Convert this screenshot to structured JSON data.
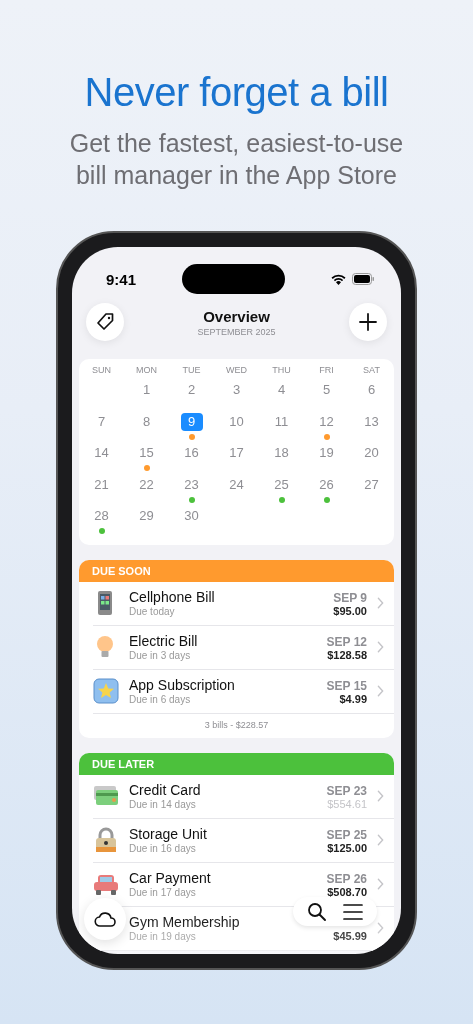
{
  "headline": "Never forget a bill",
  "subtitle": "Get the fastest, easiest-to-use bill manager in the App Store",
  "status_bar": {
    "time": "9:41"
  },
  "header": {
    "title": "Overview",
    "subtitle": "SEPTEMBER 2025"
  },
  "calendar": {
    "weekdays": [
      "SUN",
      "MON",
      "TUE",
      "WED",
      "THU",
      "FRI",
      "SAT"
    ],
    "weeks": [
      [
        {
          "day": "1",
          "selected": false
        },
        {
          "day": "2",
          "selected": false
        },
        {
          "day": "3",
          "selected": false
        },
        {
          "day": "4",
          "selected": false
        },
        {
          "day": "5",
          "selected": false
        },
        {
          "day": "6",
          "selected": false
        }
      ],
      [
        {
          "day": "7",
          "selected": false
        },
        {
          "day": "8",
          "selected": false
        },
        {
          "day": "9",
          "selected": true,
          "color": "#ff9a2e"
        },
        {
          "day": "10",
          "selected": false
        },
        {
          "day": "11",
          "selected": false
        },
        {
          "day": "12",
          "selected": false,
          "color": "#ff9a2e"
        },
        {
          "day": "13",
          "selected": false
        }
      ],
      [
        {
          "day": "14",
          "selected": false
        },
        {
          "day": "15",
          "selected": false,
          "color": "#ff9a2e"
        },
        {
          "day": "16",
          "selected": false
        },
        {
          "day": "17",
          "selected": false
        },
        {
          "day": "18",
          "selected": false
        },
        {
          "day": "19",
          "selected": false
        },
        {
          "day": "20",
          "selected": false
        }
      ],
      [
        {
          "day": "21",
          "selected": false
        },
        {
          "day": "22",
          "selected": false
        },
        {
          "day": "23",
          "selected": false,
          "color": "#4cc13c"
        },
        {
          "day": "24",
          "selected": false
        },
        {
          "day": "25",
          "selected": false,
          "color": "#4cc13c"
        },
        {
          "day": "26",
          "selected": false,
          "color": "#4cc13c"
        },
        {
          "day": "27",
          "selected": false
        }
      ],
      [
        {
          "day": "28",
          "selected": false,
          "color": "#4cc13c"
        },
        {
          "day": "29",
          "selected": false
        },
        {
          "day": "30",
          "selected": false
        }
      ]
    ]
  },
  "sections": [
    {
      "title": "DUE SOON",
      "color": "#ff9a2e",
      "footer": "3 bills - $228.57",
      "bills": [
        {
          "kind": "phone",
          "name": "Cellphone Bill",
          "due": "Due today",
          "date": "SEP 9",
          "amount": "$95.00",
          "estimated": false
        },
        {
          "kind": "bulb",
          "name": "Electric Bill",
          "due": "Due in 3 days",
          "date": "SEP 12",
          "amount": "$128.58",
          "estimated": false
        },
        {
          "kind": "star",
          "name": "App Subscription",
          "due": "Due in 6 days",
          "date": "SEP 15",
          "amount": "$4.99",
          "estimated": false
        }
      ]
    },
    {
      "title": "DUE LATER",
      "color": "#4cc13c",
      "bills": [
        {
          "kind": "card",
          "name": "Credit Card",
          "due": "Due in 14 days",
          "date": "SEP 23",
          "amount": "$554.61",
          "estimated": true
        },
        {
          "kind": "lock",
          "name": "Storage Unit",
          "due": "Due in 16 days",
          "date": "SEP 25",
          "amount": "$125.00",
          "estimated": false
        },
        {
          "kind": "car",
          "name": "Car Payment",
          "due": "Due in 17 days",
          "date": "SEP 26",
          "amount": "$508.70",
          "estimated": false
        },
        {
          "name": "Gym Membership",
          "due": "Due in 19 days",
          "amount": "$45.99",
          "estimated": false
        }
      ]
    }
  ]
}
